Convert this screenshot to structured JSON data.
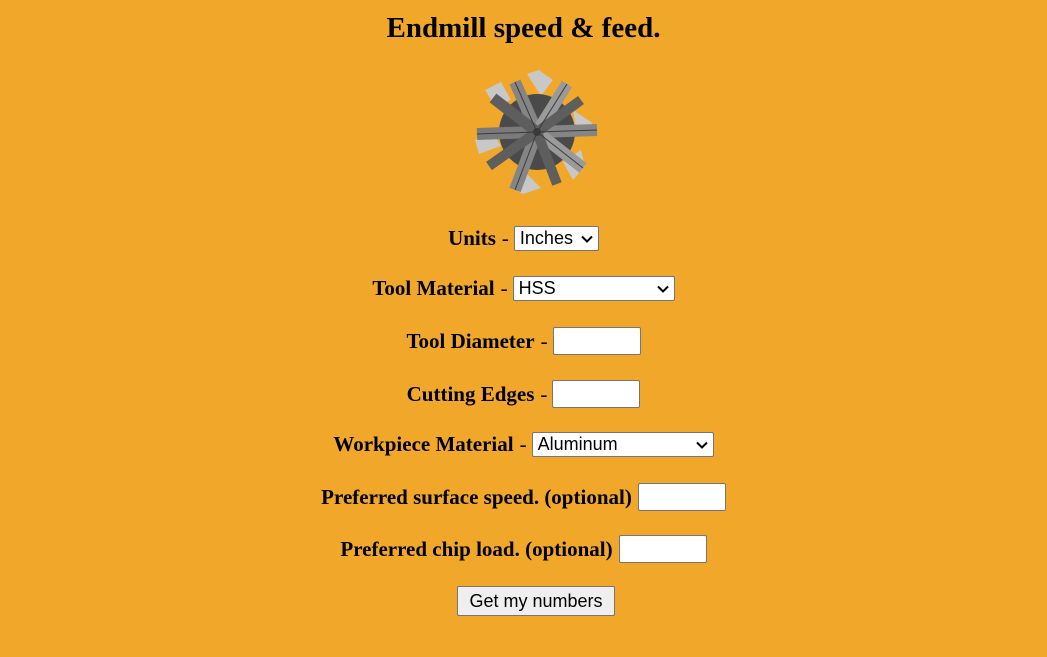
{
  "page": {
    "title": "Endmill speed & feed."
  },
  "form": {
    "dash": "-",
    "units": {
      "label": "Units",
      "value": "Inches"
    },
    "tool_material": {
      "label": "Tool Material",
      "value": "HSS"
    },
    "tool_diameter": {
      "label": "Tool Diameter",
      "value": ""
    },
    "cutting_edges": {
      "label": "Cutting Edges",
      "value": ""
    },
    "workpiece_material": {
      "label": "Workpiece Material",
      "value": "Aluminum"
    },
    "surface_speed": {
      "label": "Preferred surface speed. (optional)",
      "value": ""
    },
    "chip_load": {
      "label": "Preferred chip load. (optional)",
      "value": ""
    },
    "submit_label": "Get my numbers"
  },
  "icons": {
    "logo": "endmill-icon",
    "dropdown": "chevron-down-icon"
  },
  "colors": {
    "background": "#f0a72a",
    "endmill_dark": "#4a4a4a",
    "endmill_mid": "#858585",
    "endmill_light": "#c8c8c8"
  }
}
